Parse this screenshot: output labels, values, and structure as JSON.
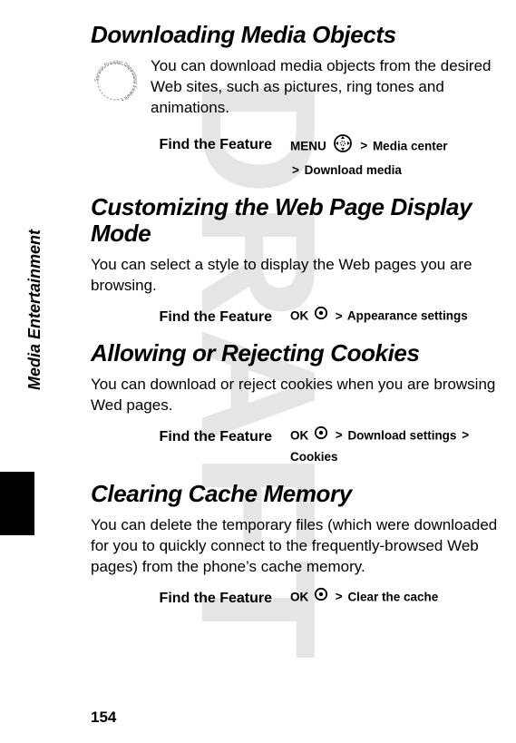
{
  "watermark": "DRAFT",
  "side_label": "Media Entertainment",
  "page_number": "154",
  "find_label": "Find the Feature",
  "keys": {
    "menu": "MENU",
    "ok": "OK",
    "gt": ">"
  },
  "sections": {
    "download": {
      "heading": "Downloading Media Objects",
      "body": "You can download media objects from the desired Web sites, such as pictures, ring tones and animations.",
      "path1a": "Media center",
      "path2a": "Download media"
    },
    "customize": {
      "heading": "Customizing the Web Page Display Mode",
      "body": "You can select a style to display the Web pages you are browsing.",
      "path1a": "Appearance settings"
    },
    "cookies": {
      "heading": "Allowing or Rejecting Cookies",
      "body": "You can download or reject cookies when you are browsing Wed pages.",
      "path1a": "Download settings",
      "path1b": "Cookies"
    },
    "cache": {
      "heading": "Clearing Cache Memory",
      "body": "You can delete the temporary files (which were downloaded for you to quickly connect to the frequently-browsed Web pages) from the phone’s cache memory.",
      "path1a": "Clear the cache"
    }
  }
}
